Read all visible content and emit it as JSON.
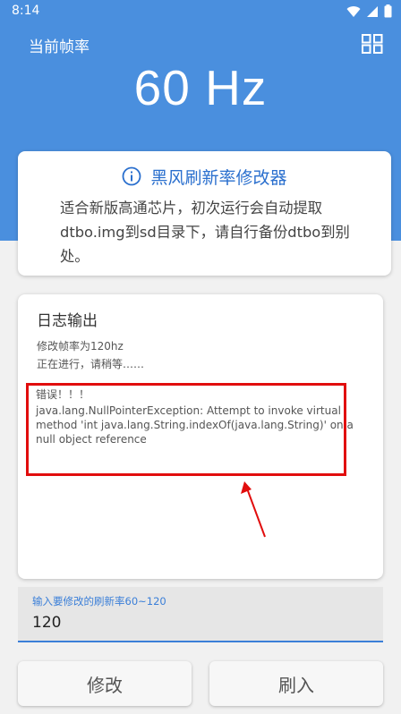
{
  "status_bar": {
    "time": "8:14"
  },
  "header": {
    "title": "当前帧率",
    "refresh_rate": "60 Hz",
    "grid_icon": "grid-icon"
  },
  "info_card": {
    "icon": "info-icon",
    "title": "黑风刷新率修改器",
    "description": "适合新版高通芯片，初次运行会自动提取dtbo.img到sd目录下，请自行备份dtbo到别处。"
  },
  "log": {
    "title": "日志输出",
    "lines": [
      "修改帧率为120hz",
      "正在进行，请稍等……"
    ],
    "error_title": "错误！！！",
    "error_message": "java.lang.NullPointerException: Attempt to invoke virtual method 'int java.lang.String.indexOf(java.lang.String)' on a null object reference"
  },
  "input": {
    "label": "输入要修改的刷新率60~120",
    "value": "120"
  },
  "buttons": {
    "modify": "修改",
    "flash": "刷入"
  },
  "colors": {
    "header_blue": "#4a8fde",
    "accent_blue": "#2a6fce",
    "annotation_red": "#e10d0d"
  }
}
